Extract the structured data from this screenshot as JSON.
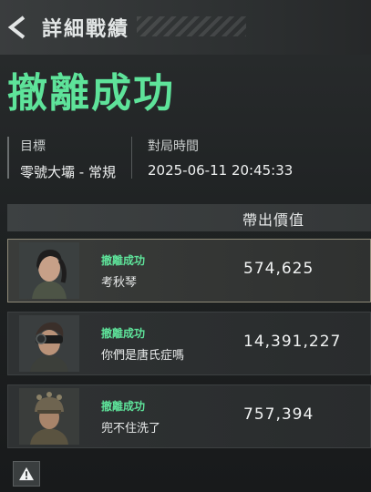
{
  "header": {
    "title": "詳細戰績"
  },
  "result": {
    "title": "撤離成功"
  },
  "info": {
    "target_label": "目標",
    "target_value": "零號大壩 - 常規",
    "time_label": "對局時間",
    "time_value": "2025-06-11 20:45:33"
  },
  "table": {
    "column_header": "帶出價值",
    "rows": [
      {
        "status": "撤離成功",
        "name": "考秋琴",
        "value": "574,625",
        "avatar_icon": "operator-portrait-female",
        "self": true
      },
      {
        "status": "撤離成功",
        "name": "你們是唐氏症嗎",
        "value": "14,391,227",
        "avatar_icon": "operator-portrait-goggles",
        "self": false
      },
      {
        "status": "撤離成功",
        "name": "兜不住洗了",
        "value": "757,394",
        "avatar_icon": "operator-portrait-helmet",
        "self": false
      }
    ]
  },
  "footer": {
    "warn_icon": "warning-icon"
  },
  "colors": {
    "accent_green": "#5ee39a",
    "self_border": "#8f8a78"
  }
}
